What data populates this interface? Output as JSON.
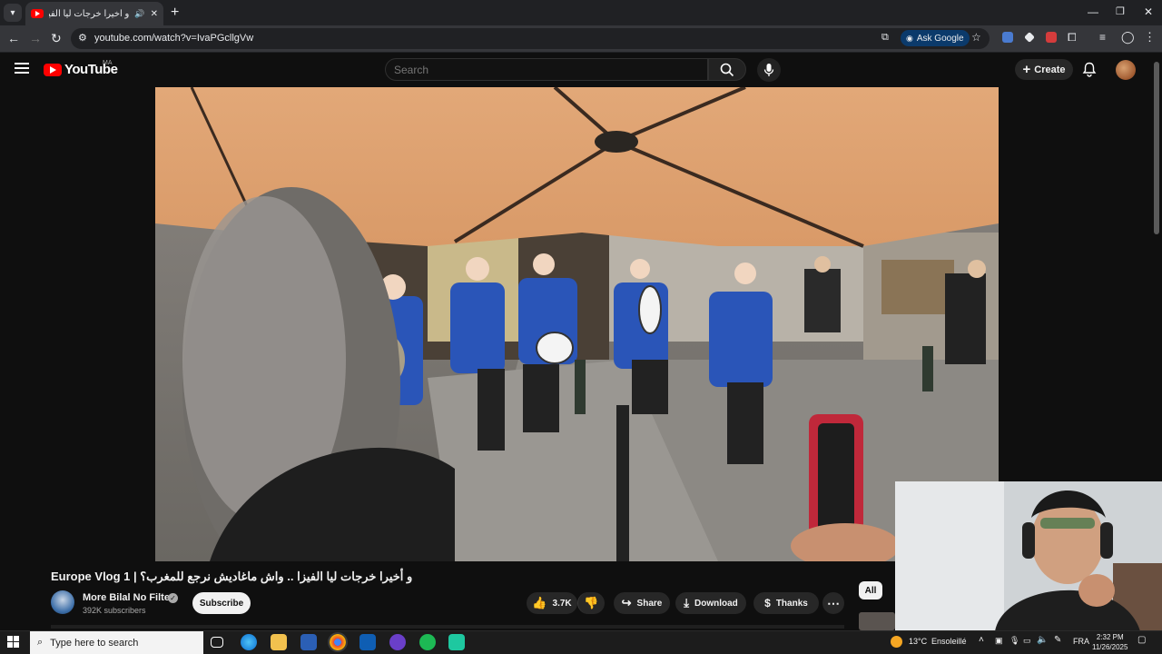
{
  "browser": {
    "tab_title": "و أخيرا خرجات ليا الفيزا .. واش",
    "url": "youtube.com/watch?v=IvaPGcllgVw",
    "ask_google_label": "Ask Google"
  },
  "youtube": {
    "logo_text": "YouTube",
    "country_code": "MA",
    "search_placeholder": "Search",
    "create_label": "Create"
  },
  "video": {
    "title": "Europe Vlog 1 | و أخيرا خرجات ليا الفيزا .. واش ماغاديش نرجع للمغرب؟",
    "channel_name": "More Bilal No Filter",
    "subscribers": "392K subscribers",
    "subscribe_label": "Subscribe",
    "likes": "3.7K",
    "share_label": "Share",
    "download_label": "Download",
    "thanks_label": "Thanks"
  },
  "sidebar": {
    "chip_all": "All"
  },
  "taskbar": {
    "search_placeholder": "Type here to search",
    "weather_temp": "13°C",
    "weather_text": "Ensoleillé",
    "language": "FRA",
    "time": "2:32 PM",
    "date": "11/26/2025"
  },
  "colors": {
    "youtube_red": "#ff0000",
    "background": "#0f0f0f",
    "ask_google_bg": "#0b3a6b"
  }
}
